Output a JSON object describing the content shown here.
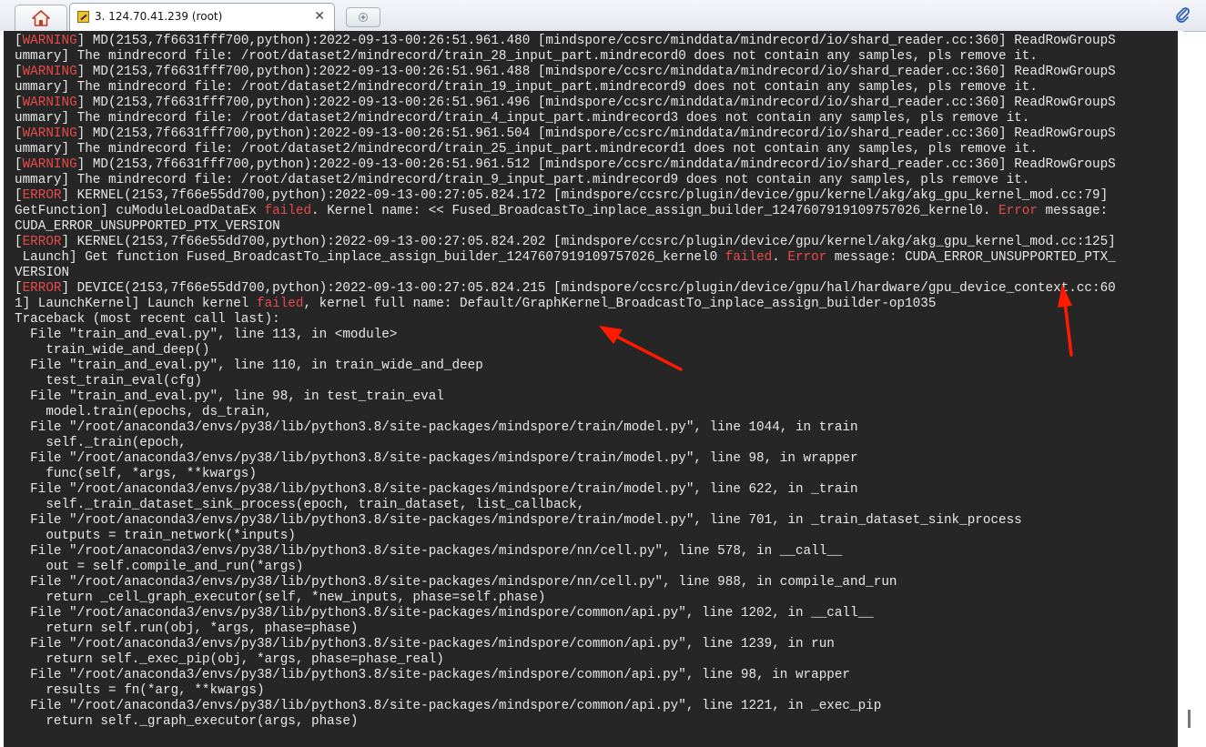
{
  "tabs": {
    "home_icon": "home-icon",
    "session_title": "3. 124.70.41.239 (root)",
    "close_glyph": "✕",
    "new_tab_icon": "new-tab-icon"
  },
  "toolbar": {
    "attach_icon": "paperclip-icon"
  },
  "colors": {
    "terminal_bg": "#262626",
    "terminal_fg": "#e8e8e8",
    "highlight": "#e84a4a",
    "annotation_arrow": "#ff1a00"
  },
  "terminal": {
    "lines": [
      [
        {
          "t": "[",
          "c": ""
        },
        {
          "t": "WARNING",
          "c": "red"
        },
        {
          "t": "] MD(2153,7f6631fff700,python):2022-09-13-00:26:51.961.480 [mindspore/ccsrc/minddata/mindrecord/io/shard_reader.cc:360] ReadRowGroupS",
          "c": ""
        }
      ],
      [
        {
          "t": "ummary] The mindrecord file: /root/dataset2/mindrecord/train_28_input_part.mindrecord0 does not contain any samples, pls remove it.",
          "c": ""
        }
      ],
      [
        {
          "t": "[",
          "c": ""
        },
        {
          "t": "WARNING",
          "c": "red"
        },
        {
          "t": "] MD(2153,7f6631fff700,python):2022-09-13-00:26:51.961.488 [mindspore/ccsrc/minddata/mindrecord/io/shard_reader.cc:360] ReadRowGroupS",
          "c": ""
        }
      ],
      [
        {
          "t": "ummary] The mindrecord file: /root/dataset2/mindrecord/train_19_input_part.mindrecord9 does not contain any samples, pls remove it.",
          "c": ""
        }
      ],
      [
        {
          "t": "[",
          "c": ""
        },
        {
          "t": "WARNING",
          "c": "red"
        },
        {
          "t": "] MD(2153,7f6631fff700,python):2022-09-13-00:26:51.961.496 [mindspore/ccsrc/minddata/mindrecord/io/shard_reader.cc:360] ReadRowGroupS",
          "c": ""
        }
      ],
      [
        {
          "t": "ummary] The mindrecord file: /root/dataset2/mindrecord/train_4_input_part.mindrecord3 does not contain any samples, pls remove it.",
          "c": ""
        }
      ],
      [
        {
          "t": "[",
          "c": ""
        },
        {
          "t": "WARNING",
          "c": "red"
        },
        {
          "t": "] MD(2153,7f6631fff700,python):2022-09-13-00:26:51.961.504 [mindspore/ccsrc/minddata/mindrecord/io/shard_reader.cc:360] ReadRowGroupS",
          "c": ""
        }
      ],
      [
        {
          "t": "ummary] The mindrecord file: /root/dataset2/mindrecord/train_25_input_part.mindrecord1 does not contain any samples, pls remove it.",
          "c": ""
        }
      ],
      [
        {
          "t": "[",
          "c": ""
        },
        {
          "t": "WARNING",
          "c": "red"
        },
        {
          "t": "] MD(2153,7f6631fff700,python):2022-09-13-00:26:51.961.512 [mindspore/ccsrc/minddata/mindrecord/io/shard_reader.cc:360] ReadRowGroupS",
          "c": ""
        }
      ],
      [
        {
          "t": "ummary] The mindrecord file: /root/dataset2/mindrecord/train_9_input_part.mindrecord9 does not contain any samples, pls remove it.",
          "c": ""
        }
      ],
      [
        {
          "t": "[",
          "c": ""
        },
        {
          "t": "ERROR",
          "c": "red"
        },
        {
          "t": "] KERNEL(2153,7f66e55dd700,python):2022-09-13-00:27:05.824.172 [mindspore/ccsrc/plugin/device/gpu/kernel/akg/akg_gpu_kernel_mod.cc:79]",
          "c": ""
        }
      ],
      [
        {
          "t": "GetFunction] cuModuleLoadDataEx ",
          "c": ""
        },
        {
          "t": "failed",
          "c": "red"
        },
        {
          "t": ". Kernel name: << Fused_BroadcastTo_inplace_assign_builder_1247607919109757026_kernel0. ",
          "c": ""
        },
        {
          "t": "Error",
          "c": "red"
        },
        {
          "t": " message:",
          "c": ""
        }
      ],
      [
        {
          "t": "CUDA_ERROR_UNSUPPORTED_PTX_VERSION",
          "c": ""
        }
      ],
      [
        {
          "t": "[",
          "c": ""
        },
        {
          "t": "ERROR",
          "c": "red"
        },
        {
          "t": "] KERNEL(2153,7f66e55dd700,python):2022-09-13-00:27:05.824.202 [mindspore/ccsrc/plugin/device/gpu/kernel/akg/akg_gpu_kernel_mod.cc:125]",
          "c": ""
        }
      ],
      [
        {
          "t": " Launch] Get function Fused_BroadcastTo_inplace_assign_builder_1247607919109757026_kernel0 ",
          "c": ""
        },
        {
          "t": "failed",
          "c": "red"
        },
        {
          "t": ". ",
          "c": ""
        },
        {
          "t": "Error",
          "c": "red"
        },
        {
          "t": " message: CUDA_ERROR_UNSUPPORTED_PTX_",
          "c": ""
        }
      ],
      [
        {
          "t": "VERSION",
          "c": ""
        }
      ],
      [
        {
          "t": "[",
          "c": ""
        },
        {
          "t": "ERROR",
          "c": "red"
        },
        {
          "t": "] DEVICE(2153,7f66e55dd700,python):2022-09-13-00:27:05.824.215 [mindspore/ccsrc/plugin/device/gpu/hal/hardware/gpu_device_context.cc:60",
          "c": ""
        }
      ],
      [
        {
          "t": "1] LaunchKernel] Launch kernel ",
          "c": ""
        },
        {
          "t": "failed",
          "c": "red"
        },
        {
          "t": ", kernel full name: Default/GraphKernel_BroadcastTo_inplace_assign_builder-op1035",
          "c": ""
        }
      ],
      [
        {
          "t": "Traceback (most recent call last):",
          "c": ""
        }
      ],
      [
        {
          "t": "  File \"train_and_eval.py\", line 113, in <module>",
          "c": ""
        }
      ],
      [
        {
          "t": "    train_wide_and_deep()",
          "c": ""
        }
      ],
      [
        {
          "t": "  File \"train_and_eval.py\", line 110, in train_wide_and_deep",
          "c": ""
        }
      ],
      [
        {
          "t": "    test_train_eval(cfg)",
          "c": ""
        }
      ],
      [
        {
          "t": "  File \"train_and_eval.py\", line 98, in test_train_eval",
          "c": ""
        }
      ],
      [
        {
          "t": "    model.train(epochs, ds_train,",
          "c": ""
        }
      ],
      [
        {
          "t": "  File \"/root/anaconda3/envs/py38/lib/python3.8/site-packages/mindspore/train/model.py\", line 1044, in train",
          "c": ""
        }
      ],
      [
        {
          "t": "    self._train(epoch,",
          "c": ""
        }
      ],
      [
        {
          "t": "  File \"/root/anaconda3/envs/py38/lib/python3.8/site-packages/mindspore/train/model.py\", line 98, in wrapper",
          "c": ""
        }
      ],
      [
        {
          "t": "    func(self, *args, **kwargs)",
          "c": ""
        }
      ],
      [
        {
          "t": "  File \"/root/anaconda3/envs/py38/lib/python3.8/site-packages/mindspore/train/model.py\", line 622, in _train",
          "c": ""
        }
      ],
      [
        {
          "t": "    self._train_dataset_sink_process(epoch, train_dataset, list_callback,",
          "c": ""
        }
      ],
      [
        {
          "t": "  File \"/root/anaconda3/envs/py38/lib/python3.8/site-packages/mindspore/train/model.py\", line 701, in _train_dataset_sink_process",
          "c": ""
        }
      ],
      [
        {
          "t": "    outputs = train_network(*inputs)",
          "c": ""
        }
      ],
      [
        {
          "t": "  File \"/root/anaconda3/envs/py38/lib/python3.8/site-packages/mindspore/nn/cell.py\", line 578, in __call__",
          "c": ""
        }
      ],
      [
        {
          "t": "    out = self.compile_and_run(*args)",
          "c": ""
        }
      ],
      [
        {
          "t": "  File \"/root/anaconda3/envs/py38/lib/python3.8/site-packages/mindspore/nn/cell.py\", line 988, in compile_and_run",
          "c": ""
        }
      ],
      [
        {
          "t": "    return _cell_graph_executor(self, *new_inputs, phase=self.phase)",
          "c": ""
        }
      ],
      [
        {
          "t": "  File \"/root/anaconda3/envs/py38/lib/python3.8/site-packages/mindspore/common/api.py\", line 1202, in __call__",
          "c": ""
        }
      ],
      [
        {
          "t": "    return self.run(obj, *args, phase=phase)",
          "c": ""
        }
      ],
      [
        {
          "t": "  File \"/root/anaconda3/envs/py38/lib/python3.8/site-packages/mindspore/common/api.py\", line 1239, in run",
          "c": ""
        }
      ],
      [
        {
          "t": "    return self._exec_pip(obj, *args, phase=phase_real)",
          "c": ""
        }
      ],
      [
        {
          "t": "  File \"/root/anaconda3/envs/py38/lib/python3.8/site-packages/mindspore/common/api.py\", line 98, in wrapper",
          "c": ""
        }
      ],
      [
        {
          "t": "    results = fn(*arg, **kwargs)",
          "c": ""
        }
      ],
      [
        {
          "t": "  File \"/root/anaconda3/envs/py38/lib/python3.8/site-packages/mindspore/common/api.py\", line 1221, in _exec_pip",
          "c": ""
        }
      ],
      [
        {
          "t": "    return self._graph_executor(args, phase)",
          "c": ""
        }
      ]
    ]
  }
}
